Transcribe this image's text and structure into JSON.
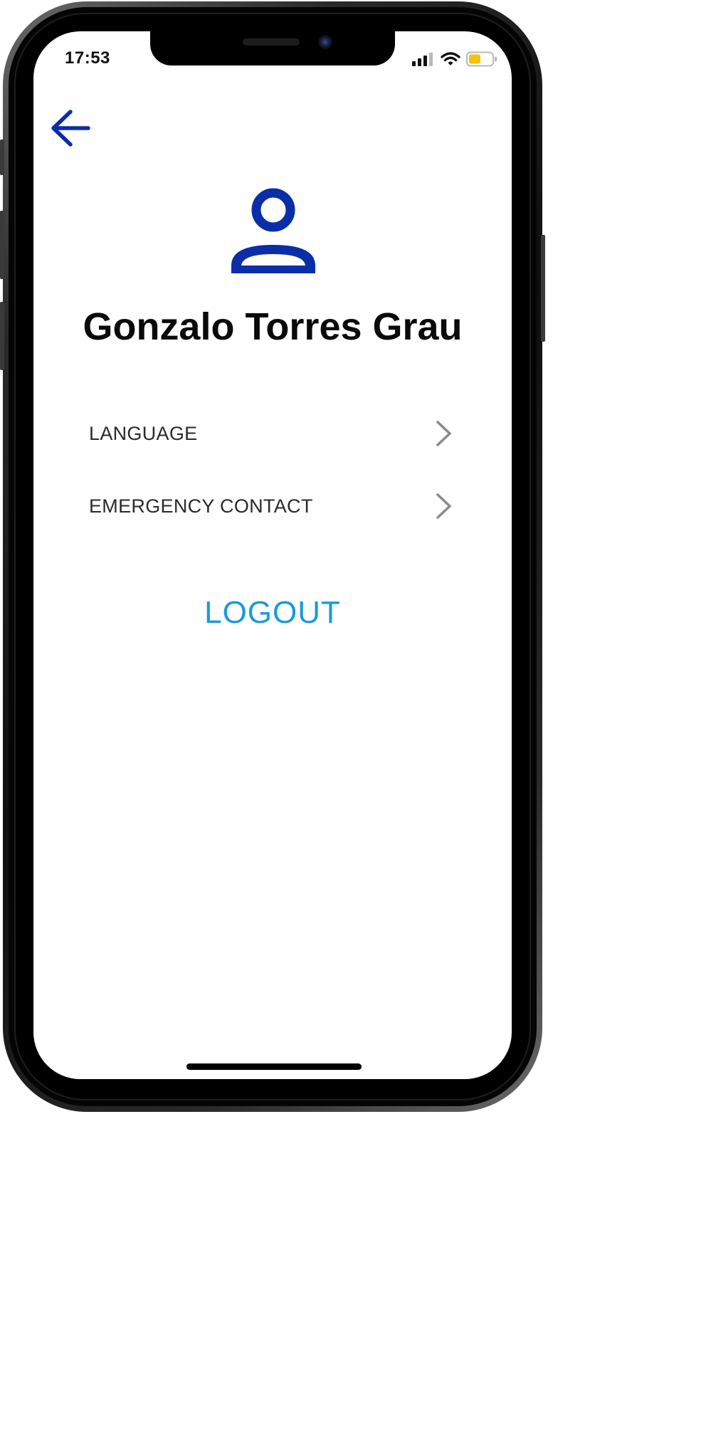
{
  "status_bar": {
    "time": "17:53",
    "icons": [
      "cellular-signal-icon",
      "wifi-icon",
      "battery-icon"
    ],
    "battery_color": "#f4c20d"
  },
  "header": {
    "back_icon": "arrow-left-icon"
  },
  "profile": {
    "avatar_icon": "user-icon",
    "name": "Gonzalo Torres Grau"
  },
  "menu": {
    "items": [
      {
        "label": "LANGUAGE",
        "icon": "chevron-right-icon"
      },
      {
        "label": "EMERGENCY CONTACT",
        "icon": "chevron-right-icon"
      }
    ]
  },
  "actions": {
    "logout_label": "LOGOUT"
  },
  "colors": {
    "accent": "#0a2ea8",
    "link": "#1a9ad6",
    "text": "#0a0a0a",
    "chevron": "#8a8a8a"
  }
}
